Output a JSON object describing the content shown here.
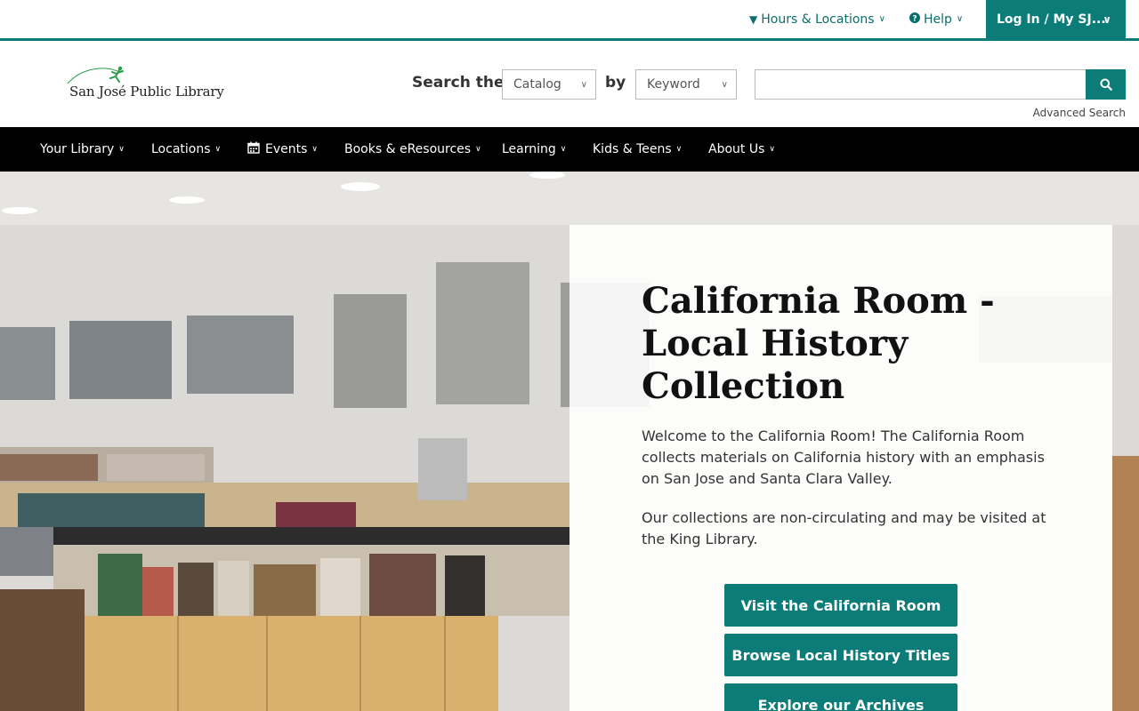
{
  "utility": {
    "hours": "Hours & Locations",
    "help": "Help",
    "login": "Log In / My SJ..."
  },
  "header": {
    "logo_text": "San José Public Library",
    "search_the": "Search the",
    "by": "by",
    "scope_selected": "Catalog",
    "field_selected": "Keyword",
    "search_value": "",
    "advanced_search": "Advanced Search"
  },
  "nav": {
    "items": [
      {
        "label": "Your Library"
      },
      {
        "label": "Locations"
      },
      {
        "label": "Events"
      },
      {
        "label": "Books & eResources"
      },
      {
        "label": "Learning"
      },
      {
        "label": "Kids & Teens"
      },
      {
        "label": "About Us"
      }
    ]
  },
  "hero": {
    "title": "California Room - Local History Collection",
    "p1": "Welcome to the California Room! The California Room collects materials on California history with an emphasis on San Jose and Santa Clara Valley.",
    "p2": "Our collections are non-circulating and may be visited at the King Library.",
    "buttons": [
      {
        "label": "Visit the California Room"
      },
      {
        "label": "Browse Local History Titles"
      },
      {
        "label": "Explore our Archives"
      }
    ]
  },
  "colors": {
    "accent": "#0b7c78",
    "nav_bg": "#000000"
  }
}
